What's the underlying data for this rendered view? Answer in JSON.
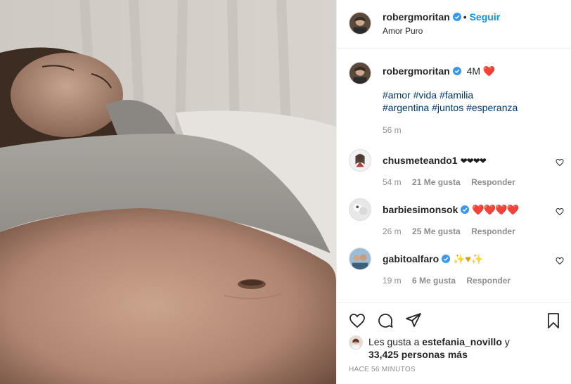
{
  "post": {
    "username": "robergmoritan",
    "follow_label": "Seguir",
    "separator": "•",
    "location": "Amor Puro"
  },
  "caption": {
    "username": "robergmoritan",
    "text": "4M",
    "emoji": "❤️",
    "hashtags_line1": [
      "#amor",
      "#vida",
      "#familia"
    ],
    "hashtags_line2": [
      "#argentina",
      "#juntos",
      "#esperanza"
    ],
    "time": "56 m"
  },
  "comments": [
    {
      "username": "chusmeteando1",
      "text": "❤❤❤❤",
      "verified": false,
      "time": "54 m",
      "likes": "21 Me gusta",
      "reply": "Responder"
    },
    {
      "username": "barbiesimonsok",
      "text": "❤️❤️❤️❤️",
      "verified": true,
      "time": "26 m",
      "likes": "25 Me gusta",
      "reply": "Responder"
    },
    {
      "username": "gabitoalfaro",
      "text": "✨♥✨",
      "verified": true,
      "time": "19 m",
      "likes": "6 Me gusta",
      "reply": "Responder"
    }
  ],
  "likes": {
    "prefix": "Les gusta a",
    "user": "estefania_novillo",
    "conjunction": "y",
    "count_text": "33,425 personas más"
  },
  "posted_ago": "HACE 56 MINUTOS",
  "colors": {
    "accent": "#0095f6",
    "verified": "#3897f0",
    "hashtag": "#00376b",
    "muted": "#8e8e8e",
    "text": "#262626"
  },
  "icons": {
    "like": "heart-outline-icon",
    "comment": "speech-bubble-icon",
    "share": "paper-plane-icon",
    "save": "bookmark-icon",
    "verified": "verified-badge-icon"
  }
}
